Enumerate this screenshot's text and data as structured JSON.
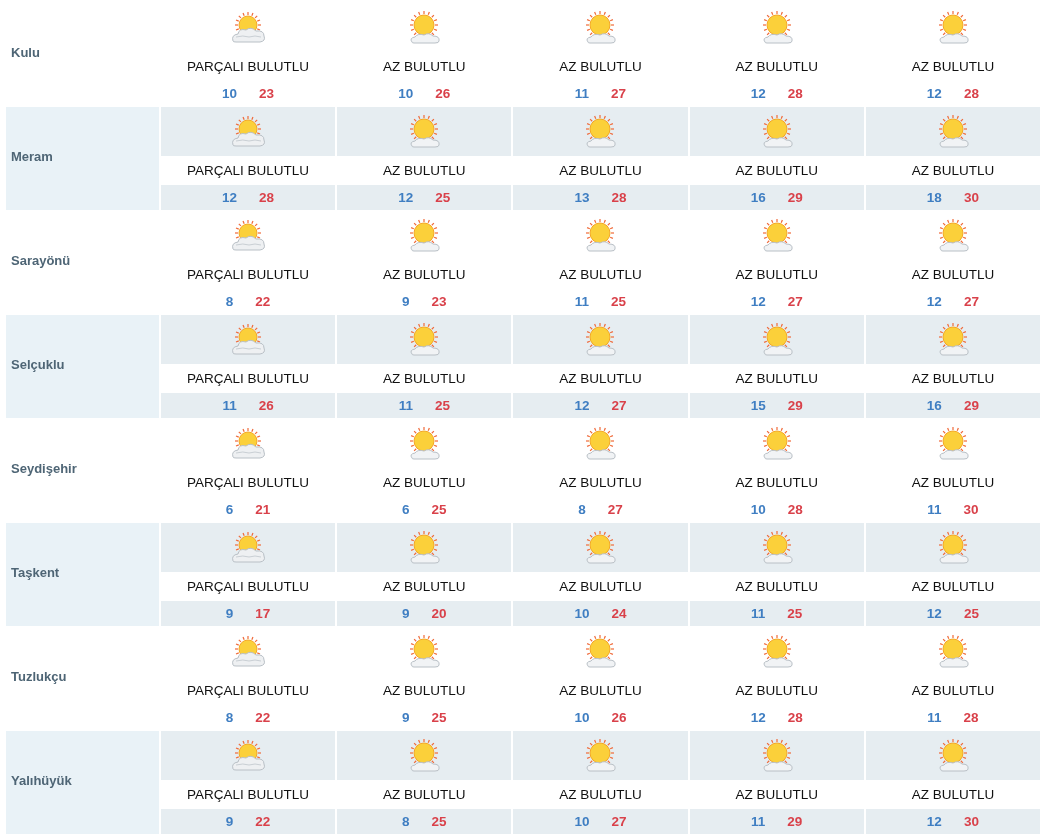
{
  "rows": [
    {
      "city": "Kulu",
      "days": [
        {
          "kind": "partly",
          "condition": "PARÇALI BULUTLU",
          "min": "10",
          "max": "23"
        },
        {
          "kind": "few",
          "condition": "AZ BULUTLU",
          "min": "10",
          "max": "26"
        },
        {
          "kind": "few",
          "condition": "AZ BULUTLU",
          "min": "11",
          "max": "27"
        },
        {
          "kind": "few",
          "condition": "AZ BULUTLU",
          "min": "12",
          "max": "28"
        },
        {
          "kind": "few",
          "condition": "AZ BULUTLU",
          "min": "12",
          "max": "28"
        }
      ]
    },
    {
      "city": "Meram",
      "days": [
        {
          "kind": "partly",
          "condition": "PARÇALI BULUTLU",
          "min": "12",
          "max": "28"
        },
        {
          "kind": "few",
          "condition": "AZ BULUTLU",
          "min": "12",
          "max": "25"
        },
        {
          "kind": "few",
          "condition": "AZ BULUTLU",
          "min": "13",
          "max": "28"
        },
        {
          "kind": "few",
          "condition": "AZ BULUTLU",
          "min": "16",
          "max": "29"
        },
        {
          "kind": "few",
          "condition": "AZ BULUTLU",
          "min": "18",
          "max": "30"
        }
      ]
    },
    {
      "city": "Sarayönü",
      "days": [
        {
          "kind": "partly",
          "condition": "PARÇALI BULUTLU",
          "min": "8",
          "max": "22"
        },
        {
          "kind": "few",
          "condition": "AZ BULUTLU",
          "min": "9",
          "max": "23"
        },
        {
          "kind": "few",
          "condition": "AZ BULUTLU",
          "min": "11",
          "max": "25"
        },
        {
          "kind": "few",
          "condition": "AZ BULUTLU",
          "min": "12",
          "max": "27"
        },
        {
          "kind": "few",
          "condition": "AZ BULUTLU",
          "min": "12",
          "max": "27"
        }
      ]
    },
    {
      "city": "Selçuklu",
      "days": [
        {
          "kind": "partly",
          "condition": "PARÇALI BULUTLU",
          "min": "11",
          "max": "26"
        },
        {
          "kind": "few",
          "condition": "AZ BULUTLU",
          "min": "11",
          "max": "25"
        },
        {
          "kind": "few",
          "condition": "AZ BULUTLU",
          "min": "12",
          "max": "27"
        },
        {
          "kind": "few",
          "condition": "AZ BULUTLU",
          "min": "15",
          "max": "29"
        },
        {
          "kind": "few",
          "condition": "AZ BULUTLU",
          "min": "16",
          "max": "29"
        }
      ]
    },
    {
      "city": "Seydişehir",
      "days": [
        {
          "kind": "partly",
          "condition": "PARÇALI BULUTLU",
          "min": "6",
          "max": "21"
        },
        {
          "kind": "few",
          "condition": "AZ BULUTLU",
          "min": "6",
          "max": "25"
        },
        {
          "kind": "few",
          "condition": "AZ BULUTLU",
          "min": "8",
          "max": "27"
        },
        {
          "kind": "few",
          "condition": "AZ BULUTLU",
          "min": "10",
          "max": "28"
        },
        {
          "kind": "few",
          "condition": "AZ BULUTLU",
          "min": "11",
          "max": "30"
        }
      ]
    },
    {
      "city": "Taşkent",
      "days": [
        {
          "kind": "partly",
          "condition": "PARÇALI BULUTLU",
          "min": "9",
          "max": "17"
        },
        {
          "kind": "few",
          "condition": "AZ BULUTLU",
          "min": "9",
          "max": "20"
        },
        {
          "kind": "few",
          "condition": "AZ BULUTLU",
          "min": "10",
          "max": "24"
        },
        {
          "kind": "few",
          "condition": "AZ BULUTLU",
          "min": "11",
          "max": "25"
        },
        {
          "kind": "few",
          "condition": "AZ BULUTLU",
          "min": "12",
          "max": "25"
        }
      ]
    },
    {
      "city": "Tuzlukçu",
      "days": [
        {
          "kind": "partly",
          "condition": "PARÇALI BULUTLU",
          "min": "8",
          "max": "22"
        },
        {
          "kind": "few",
          "condition": "AZ BULUTLU",
          "min": "9",
          "max": "25"
        },
        {
          "kind": "few",
          "condition": "AZ BULUTLU",
          "min": "10",
          "max": "26"
        },
        {
          "kind": "few",
          "condition": "AZ BULUTLU",
          "min": "12",
          "max": "28"
        },
        {
          "kind": "few",
          "condition": "AZ BULUTLU",
          "min": "11",
          "max": "28"
        }
      ]
    },
    {
      "city": "Yalıhüyük",
      "days": [
        {
          "kind": "partly",
          "condition": "PARÇALI BULUTLU",
          "min": "9",
          "max": "22"
        },
        {
          "kind": "few",
          "condition": "AZ BULUTLU",
          "min": "8",
          "max": "25"
        },
        {
          "kind": "few",
          "condition": "AZ BULUTLU",
          "min": "10",
          "max": "27"
        },
        {
          "kind": "few",
          "condition": "AZ BULUTLU",
          "min": "11",
          "max": "29"
        },
        {
          "kind": "few",
          "condition": "AZ BULUTLU",
          "min": "12",
          "max": "30"
        }
      ]
    }
  ]
}
